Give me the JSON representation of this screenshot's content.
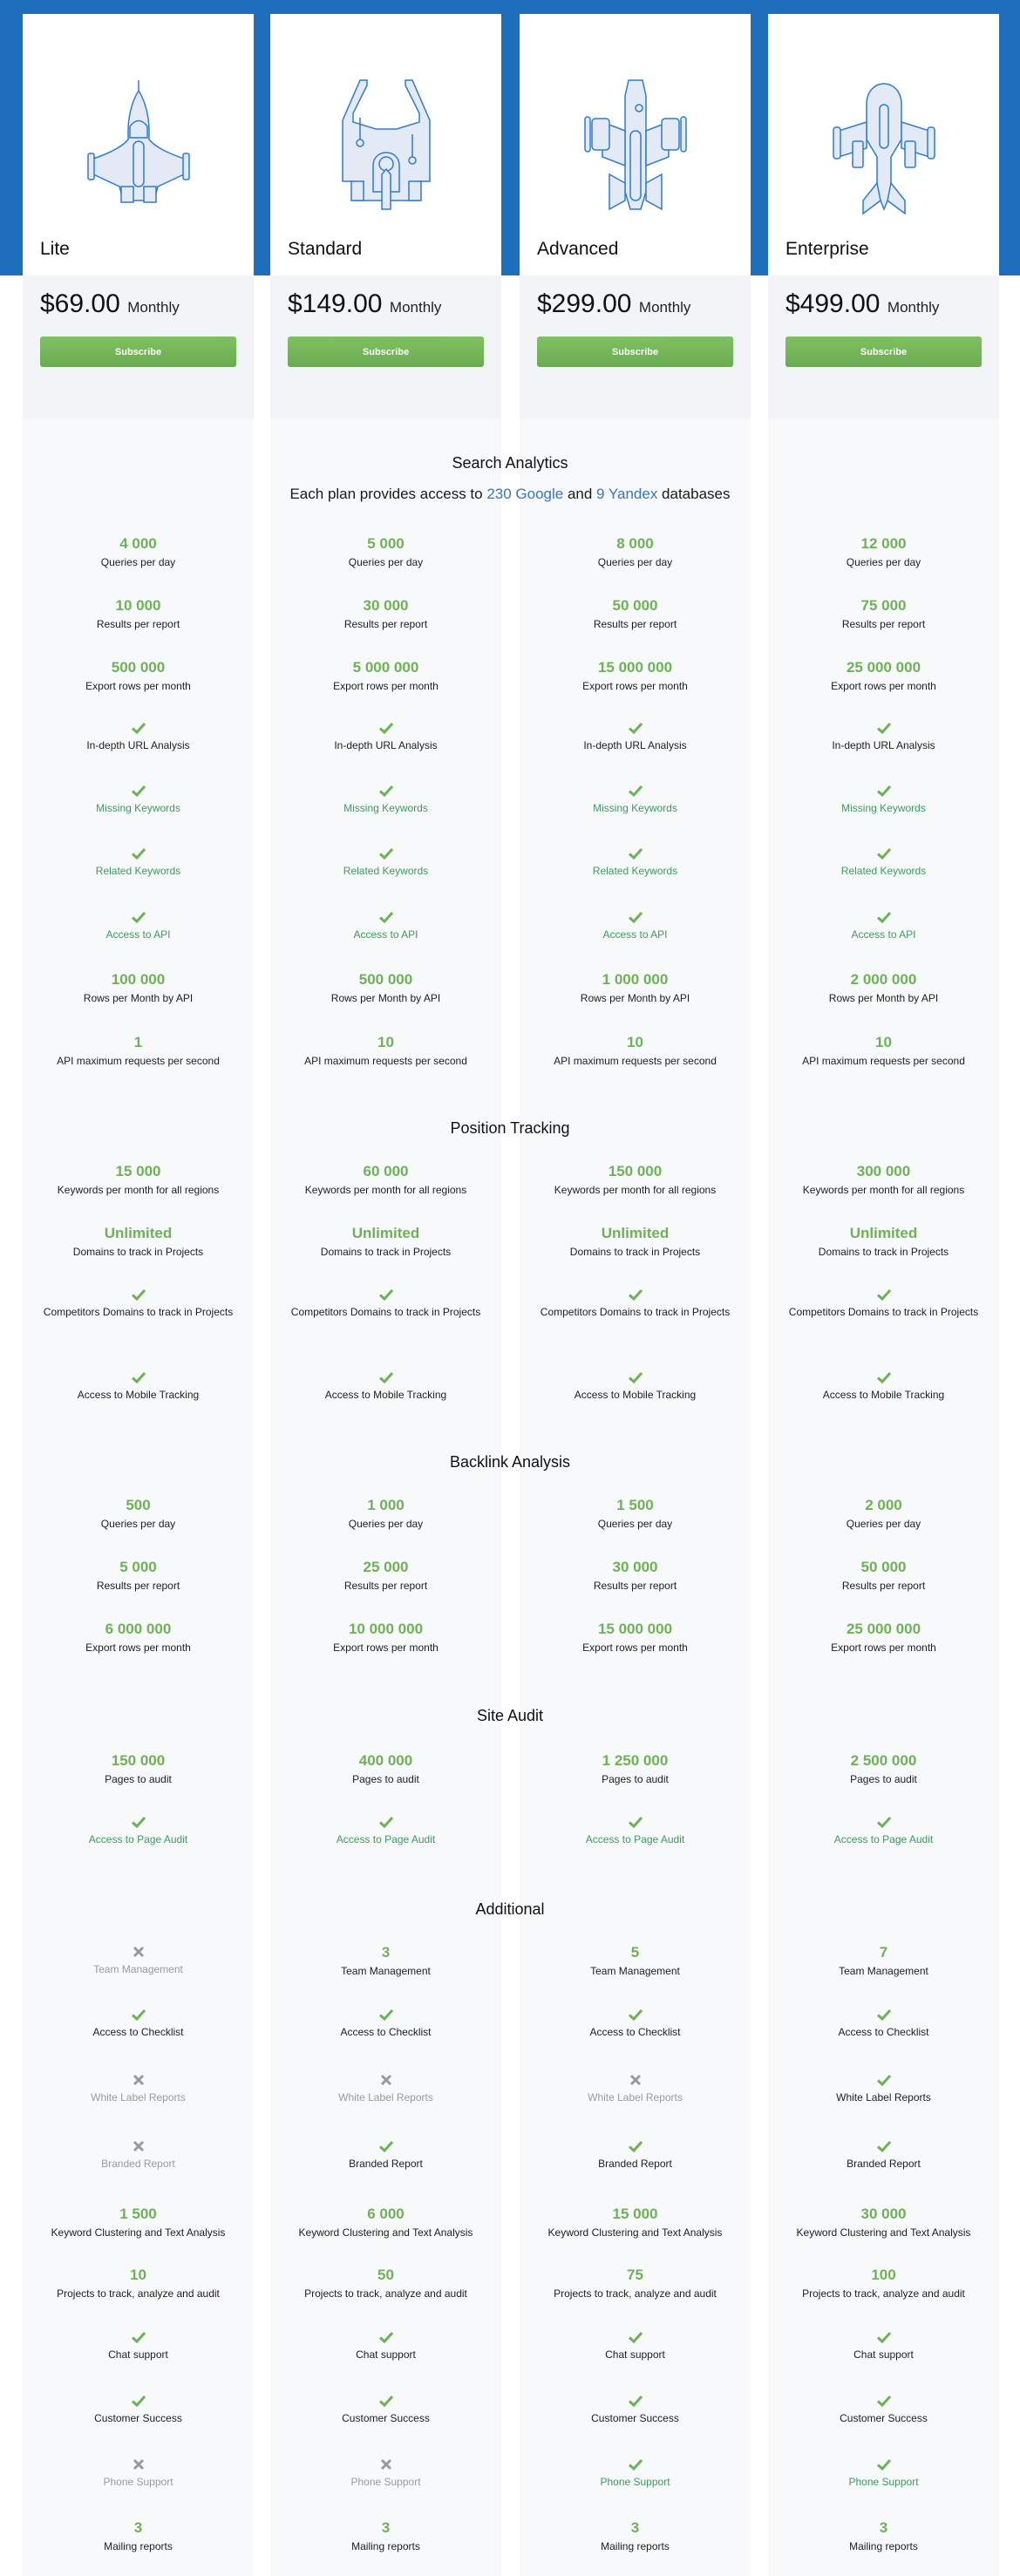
{
  "colors": {
    "brand_blue": "#1d6fbe",
    "accent_green": "#6db356",
    "link_blue": "#3a74c6",
    "off_gray": "#9a9a9a"
  },
  "plans": [
    {
      "name": "Lite",
      "price": "$69.00",
      "period": "Monthly",
      "cta": "Subscribe",
      "icon": "spaceship-lite-icon"
    },
    {
      "name": "Standard",
      "price": "$149.00",
      "period": "Monthly",
      "cta": "Subscribe",
      "icon": "spaceship-standard-icon"
    },
    {
      "name": "Advanced",
      "price": "$299.00",
      "period": "Monthly",
      "cta": "Subscribe",
      "icon": "spaceship-advanced-icon"
    },
    {
      "name": "Enterprise",
      "price": "$499.00",
      "period": "Monthly",
      "cta": "Subscribe",
      "icon": "spaceship-enterprise-icon"
    }
  ],
  "sections": [
    {
      "title": "Search Analytics",
      "subtitle": {
        "prefix": "Each plan provides access to ",
        "link1": "230 Google",
        "mid": " and ",
        "link2": "9 Yandex",
        "suffix": " databases"
      },
      "rows": [
        {
          "label": "Queries per day",
          "type": "value",
          "values": [
            "4 000",
            "5 000",
            "8 000",
            "12 000"
          ]
        },
        {
          "label": "Results per report",
          "type": "value",
          "values": [
            "10 000",
            "30 000",
            "50 000",
            "75 000"
          ]
        },
        {
          "label": "Export rows per month",
          "type": "value",
          "values": [
            "500 000",
            "5 000 000",
            "15 000 000",
            "25 000 000"
          ]
        },
        {
          "label": "In-depth URL Analysis",
          "type": "check",
          "values": [
            true,
            true,
            true,
            true
          ]
        },
        {
          "label": "Missing Keywords",
          "type": "check",
          "style": "green",
          "values": [
            true,
            true,
            true,
            true
          ]
        },
        {
          "label": "Related Keywords",
          "type": "check",
          "style": "green",
          "values": [
            true,
            true,
            true,
            true
          ]
        },
        {
          "label": "Access to API",
          "type": "check",
          "style": "green",
          "values": [
            true,
            true,
            true,
            true
          ]
        },
        {
          "label": "Rows per Month by API",
          "type": "value",
          "values": [
            "100 000",
            "500 000",
            "1 000 000",
            "2 000 000"
          ]
        },
        {
          "label": "API maximum requests per second",
          "type": "value",
          "values": [
            "1",
            "10",
            "10",
            "10"
          ]
        }
      ]
    },
    {
      "title": "Position Tracking",
      "rows": [
        {
          "label": "Keywords per month for all regions",
          "type": "value",
          "values": [
            "15 000",
            "60 000",
            "150 000",
            "300 000"
          ]
        },
        {
          "label": "Domains to track in Projects",
          "type": "value",
          "values": [
            "Unlimited",
            "Unlimited",
            "Unlimited",
            "Unlimited"
          ]
        },
        {
          "label": "Competitors Domains to track in Projects",
          "type": "check",
          "values": [
            true,
            true,
            true,
            true
          ]
        },
        {
          "label": "Access to Mobile Tracking",
          "type": "check",
          "values": [
            true,
            true,
            true,
            true
          ]
        }
      ]
    },
    {
      "title": "Backlink Analysis",
      "rows": [
        {
          "label": "Queries per day",
          "type": "value",
          "values": [
            "500",
            "1 000",
            "1 500",
            "2 000"
          ]
        },
        {
          "label": "Results per report",
          "type": "value",
          "values": [
            "5 000",
            "25 000",
            "30 000",
            "50 000"
          ]
        },
        {
          "label": "Export rows per month",
          "type": "value",
          "values": [
            "6 000 000",
            "10 000 000",
            "15 000 000",
            "25 000 000"
          ]
        }
      ]
    },
    {
      "title": "Site Audit",
      "rows": [
        {
          "label": "Pages to audit",
          "type": "value",
          "values": [
            "150 000",
            "400 000",
            "1 250 000",
            "2 500 000"
          ]
        },
        {
          "label": "Access to Page Audit",
          "type": "check",
          "style": "green",
          "values": [
            true,
            true,
            true,
            true
          ]
        }
      ]
    },
    {
      "title": "Additional",
      "rows": [
        {
          "label": "Team Management",
          "type": "mixed",
          "values": [
            false,
            "3",
            "5",
            "7"
          ]
        },
        {
          "label": "Access to Checklist",
          "type": "check",
          "values": [
            true,
            true,
            true,
            true
          ]
        },
        {
          "label": "White Label Reports",
          "type": "check",
          "values": [
            false,
            false,
            false,
            true
          ]
        },
        {
          "label": "Branded Report",
          "type": "check",
          "values": [
            false,
            true,
            true,
            true
          ]
        },
        {
          "label": "Keyword Clustering and Text Analysis",
          "type": "value",
          "values": [
            "1 500",
            "6 000",
            "15 000",
            "30 000"
          ]
        },
        {
          "label": "Projects to track, analyze and audit",
          "type": "value",
          "values": [
            "10",
            "50",
            "75",
            "100"
          ]
        },
        {
          "label": "Chat support",
          "type": "check",
          "values": [
            true,
            true,
            true,
            true
          ]
        },
        {
          "label": "Customer Success",
          "type": "check",
          "values": [
            true,
            true,
            true,
            true
          ]
        },
        {
          "label": "Phone Support",
          "type": "check",
          "style": "green",
          "values": [
            false,
            false,
            true,
            true
          ]
        },
        {
          "label": "Mailing reports",
          "type": "value",
          "values": [
            "3",
            "3",
            "3",
            "3"
          ]
        }
      ]
    }
  ]
}
